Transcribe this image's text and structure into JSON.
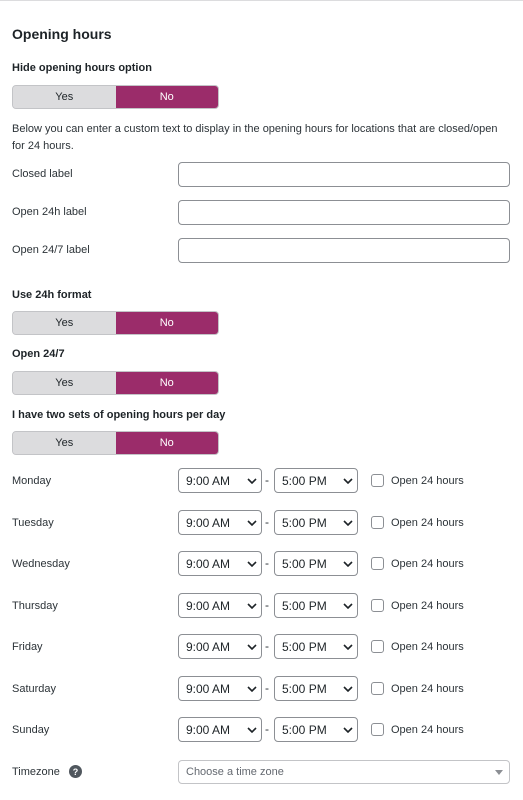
{
  "section_title": "Opening hours",
  "hide_option": {
    "label": "Hide opening hours option",
    "yes": "Yes",
    "no": "No"
  },
  "description": "Below you can enter a custom text to display in the opening hours for locations that are closed/open for 24 hours.",
  "closed_label": {
    "label": "Closed label",
    "value": ""
  },
  "open24h_label": {
    "label": "Open 24h label",
    "value": ""
  },
  "open247_label": {
    "label": "Open 24/7 label",
    "value": ""
  },
  "use24h": {
    "label": "Use 24h format",
    "yes": "Yes",
    "no": "No"
  },
  "open247": {
    "label": "Open 24/7",
    "yes": "Yes",
    "no": "No"
  },
  "two_sets": {
    "label": "I have two sets of opening hours per day",
    "yes": "Yes",
    "no": "No"
  },
  "separator": "-",
  "days": [
    {
      "name": "Monday",
      "from": "9:00 AM",
      "to": "5:00 PM",
      "open24": "Open 24 hours"
    },
    {
      "name": "Tuesday",
      "from": "9:00 AM",
      "to": "5:00 PM",
      "open24": "Open 24 hours"
    },
    {
      "name": "Wednesday",
      "from": "9:00 AM",
      "to": "5:00 PM",
      "open24": "Open 24 hours"
    },
    {
      "name": "Thursday",
      "from": "9:00 AM",
      "to": "5:00 PM",
      "open24": "Open 24 hours"
    },
    {
      "name": "Friday",
      "from": "9:00 AM",
      "to": "5:00 PM",
      "open24": "Open 24 hours"
    },
    {
      "name": "Saturday",
      "from": "9:00 AM",
      "to": "5:00 PM",
      "open24": "Open 24 hours"
    },
    {
      "name": "Sunday",
      "from": "9:00 AM",
      "to": "5:00 PM",
      "open24": "Open 24 hours"
    }
  ],
  "timezone": {
    "label": "Timezone",
    "help_icon": "question-mark-icon",
    "placeholder": "Choose a time zone"
  },
  "colors": {
    "toggle_active": "#9b2c6a",
    "toggle_inactive": "#dcdcde"
  }
}
